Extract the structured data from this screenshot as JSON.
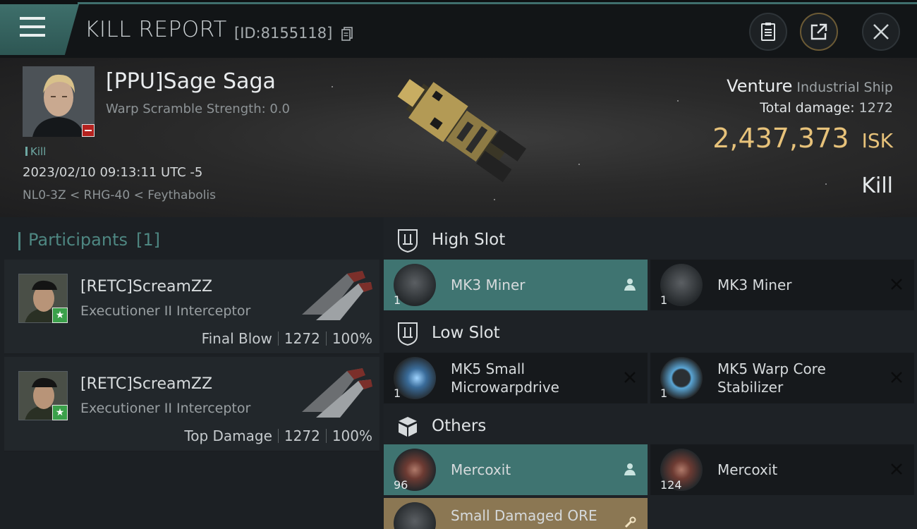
{
  "header": {
    "title": "KILL REPORT",
    "kill_id": "[ID:8155118]",
    "icons": [
      "menu-icon",
      "copy-icon",
      "clipboard-icon",
      "share-icon",
      "close-icon"
    ]
  },
  "victim": {
    "name": "[PPU]Sage Saga",
    "warp_scramble": "Warp Scramble Strength: 0.0",
    "kill_tag": "Kill",
    "datetime": "2023/02/10 09:13:11 UTC -5",
    "location": "NL0-3Z < RHG-40 < Feythabolis",
    "ship_name": "Venture",
    "ship_class": "Industrial Ship",
    "total_damage_label": "Total damage:",
    "total_damage": "1272",
    "isk_value": "2,437,373",
    "isk_unit": "ISK",
    "result": "Kill"
  },
  "participants": {
    "title": "Participants",
    "count": "[1]",
    "items": [
      {
        "name": "[RETC]ScreamZZ",
        "ship": "Executioner II Interceptor",
        "role": "Final Blow",
        "damage": "1272",
        "percent": "100%"
      },
      {
        "name": "[RETC]ScreamZZ",
        "ship": "Executioner II Interceptor",
        "role": "Top Damage",
        "damage": "1272",
        "percent": "100%"
      }
    ]
  },
  "slots": {
    "high": {
      "title": "High Slot",
      "items": [
        {
          "name": "MK3 Miner",
          "qty": "1",
          "state": "teal",
          "action": "person-icon"
        },
        {
          "name": "MK3 Miner",
          "qty": "1",
          "state": "dark",
          "action": "x-icon"
        }
      ]
    },
    "low": {
      "title": "Low Slot",
      "items": [
        {
          "name": "MK5 Small Microwarpdrive",
          "qty": "1",
          "state": "dark",
          "action": "x-icon"
        },
        {
          "name": "MK5 Warp Core Stabilizer",
          "qty": "1",
          "state": "dark",
          "action": "x-icon"
        }
      ]
    },
    "others": {
      "title": "Others",
      "items": [
        {
          "name": "Mercoxit",
          "qty": "96",
          "state": "teal",
          "action": "person-icon"
        },
        {
          "name": "Mercoxit",
          "qty": "124",
          "state": "dark",
          "action": "x-icon"
        },
        {
          "name": "Small Damaged ORE",
          "qty": "",
          "state": "gold",
          "action": "wrench-icon"
        }
      ]
    }
  },
  "colors": {
    "accent_teal": "#3f7471",
    "isk_gold": "#e7c27a",
    "drop_gold": "#8b7753",
    "badge_red": "#b5221f",
    "badge_green": "#3aa04a"
  }
}
